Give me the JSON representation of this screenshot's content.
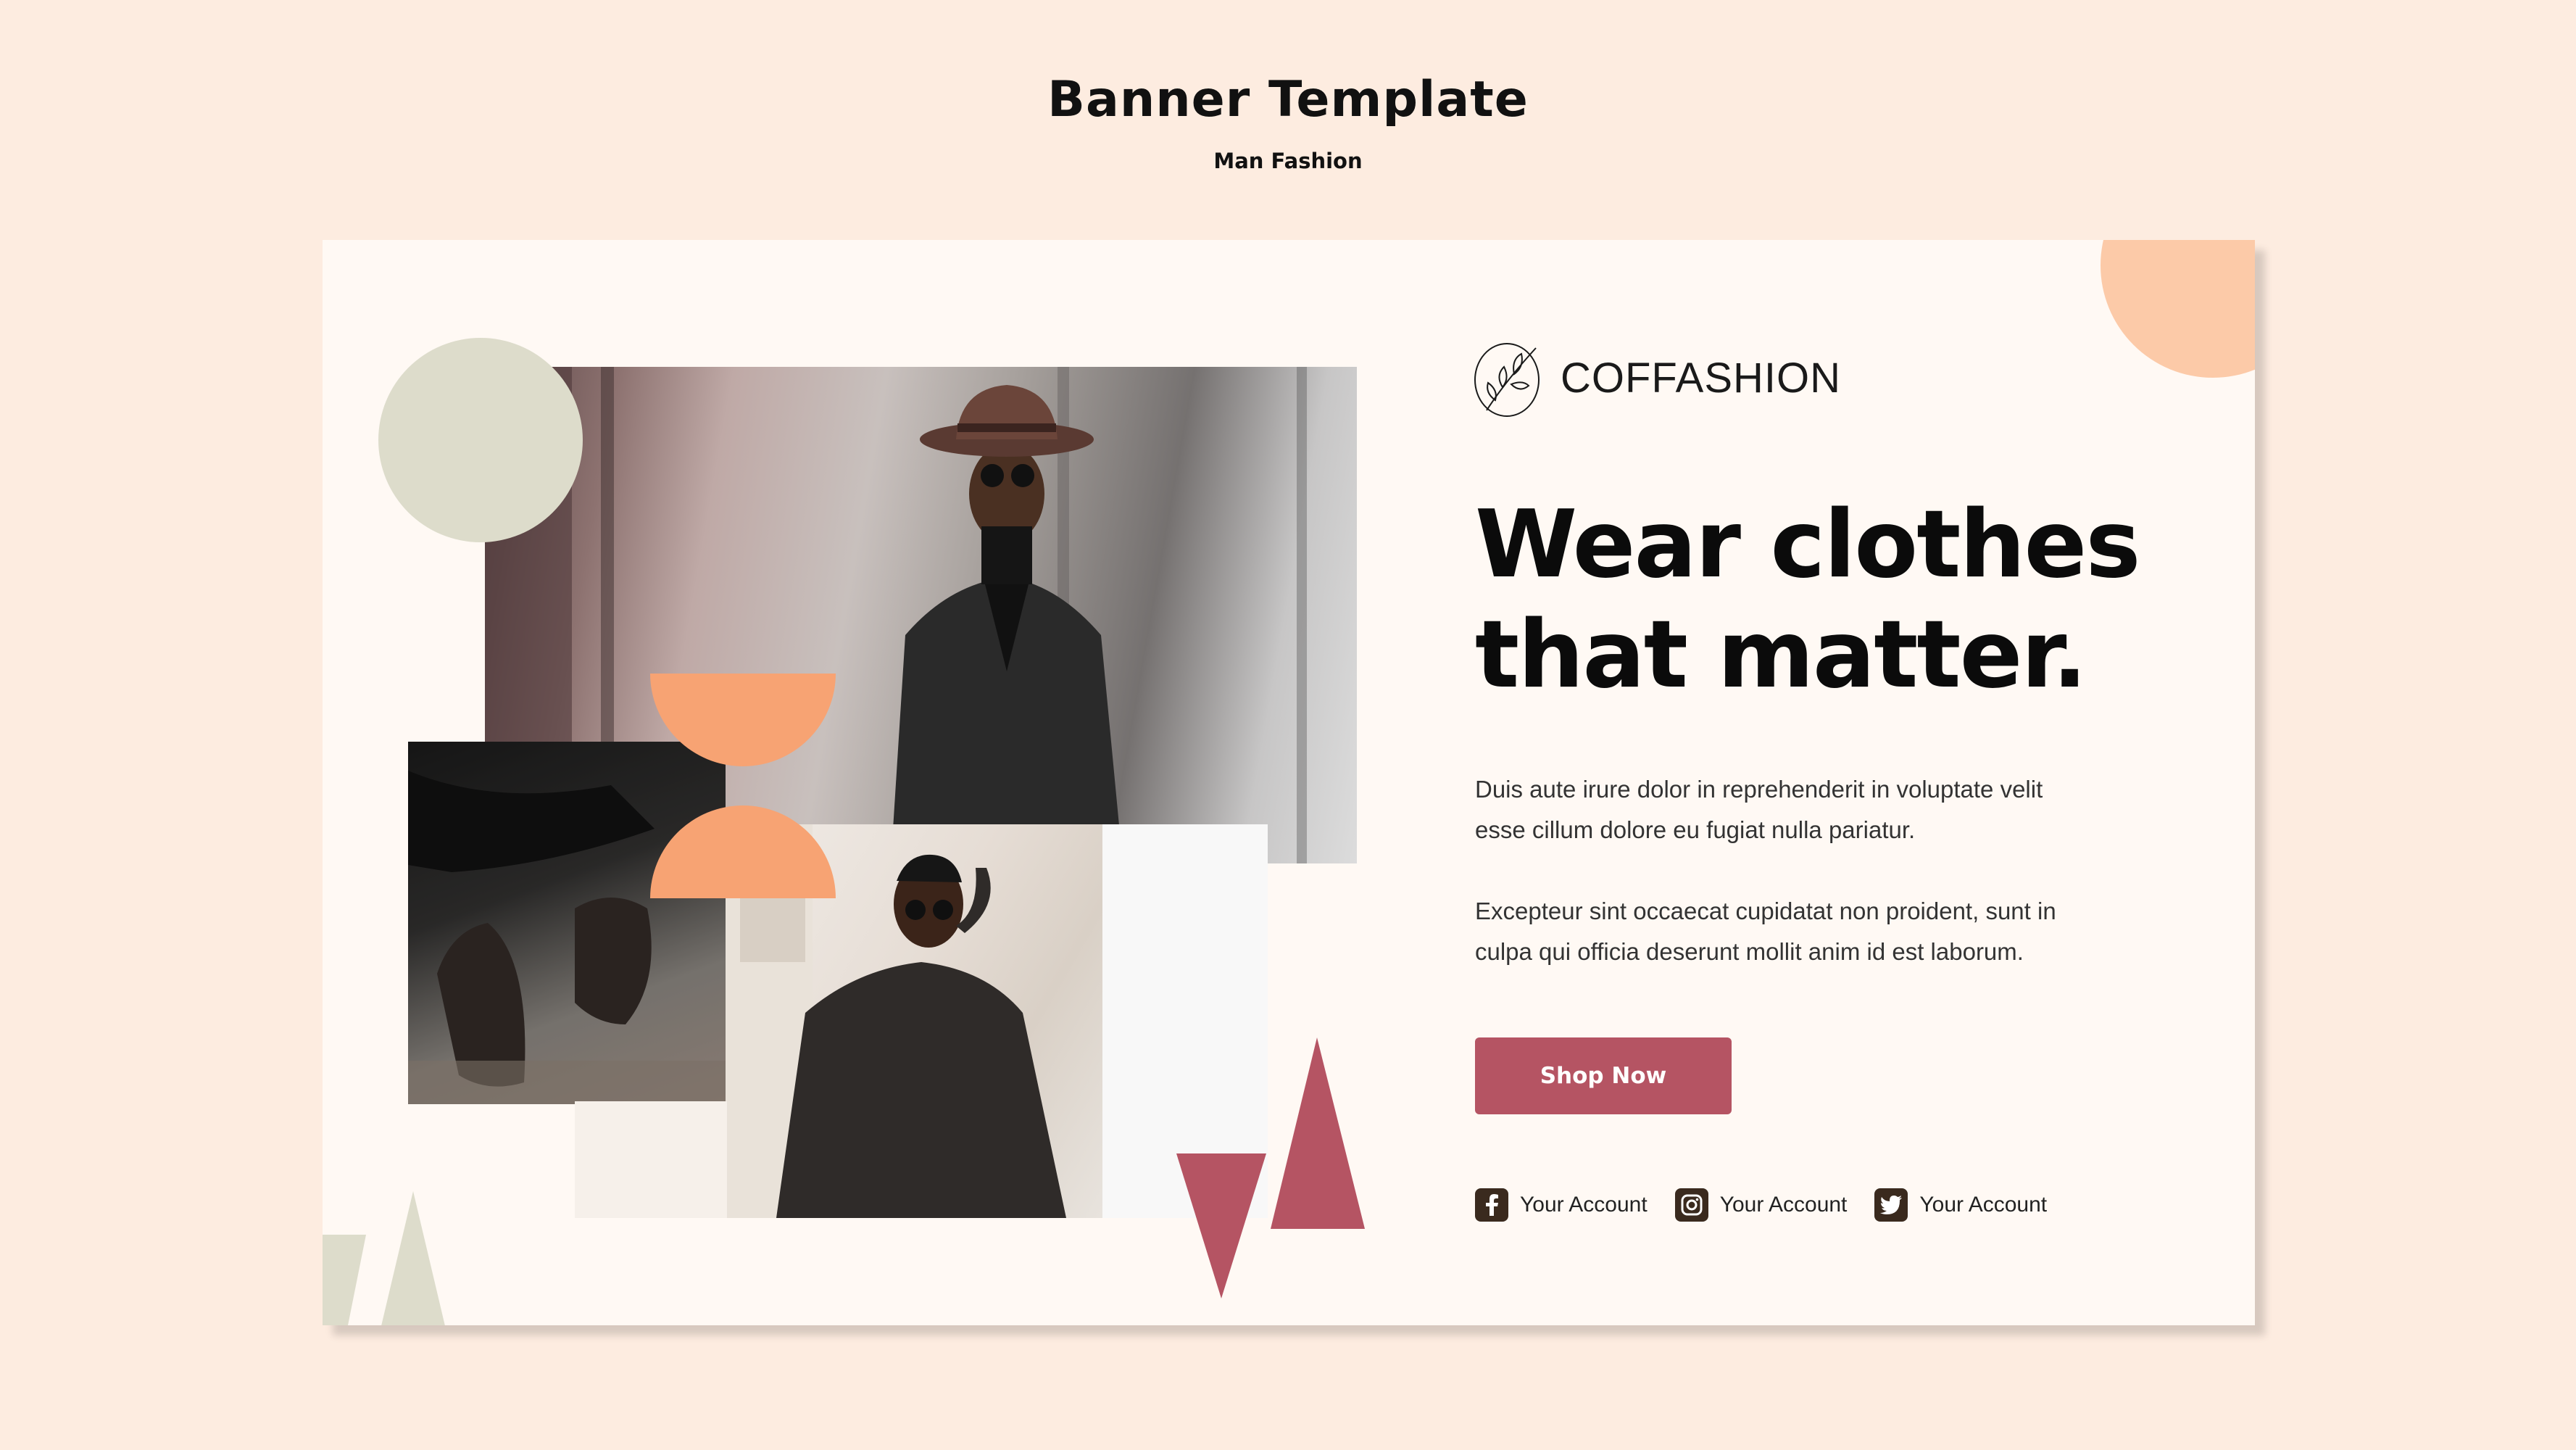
{
  "header": {
    "title": "Banner Template",
    "subtitle": "Man Fashion"
  },
  "banner": {
    "brand": "COFFASHION",
    "headline_line1": "Wear clothes",
    "headline_line2": "that matter.",
    "paragraph1_line1": "Duis aute irure dolor in reprehenderit in voluptate velit",
    "paragraph1_line2": "esse cillum dolore eu fugiat nulla pariatur.",
    "paragraph2_line1": "Excepteur sint occaecat cupidatat non proident, sunt in",
    "paragraph2_line2": "culpa qui officia deserunt mollit anim id est laborum.",
    "cta_label": "Shop Now",
    "socials": [
      {
        "icon": "facebook-icon",
        "label": "Your Account"
      },
      {
        "icon": "instagram-icon",
        "label": "Your Account"
      },
      {
        "icon": "twitter-icon",
        "label": "Your Account"
      }
    ]
  },
  "colors": {
    "page_background": "#fdece0",
    "banner_background": "#fff9f4",
    "accent_rose": "#b55463",
    "accent_orange": "#f7a373",
    "accent_peach": "#fccaa8",
    "accent_sage": "#dddccb",
    "icon_dark": "#3a2a1e"
  }
}
